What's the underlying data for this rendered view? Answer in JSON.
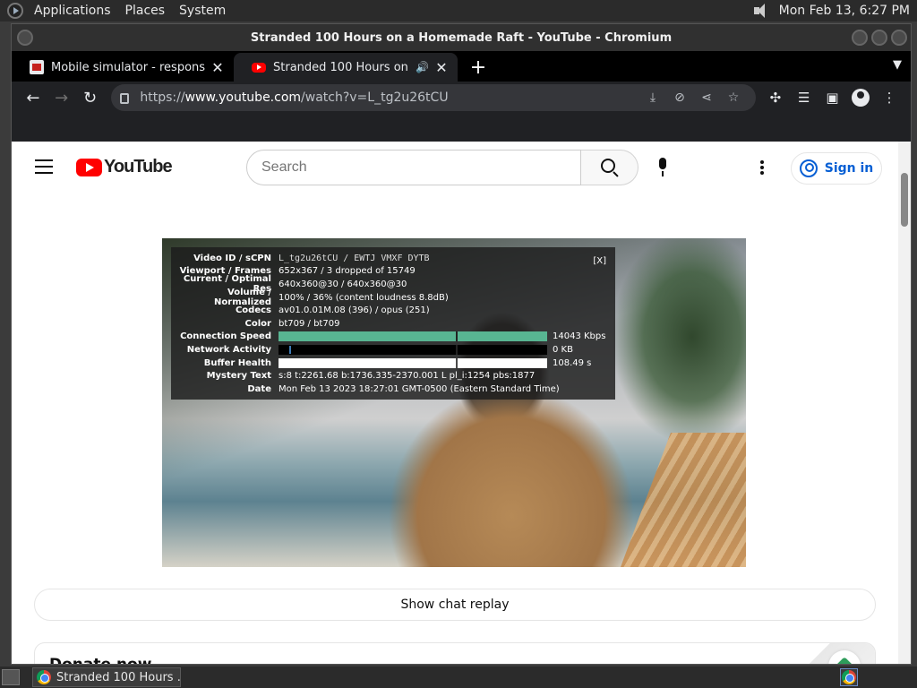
{
  "desktop": {
    "menus": [
      "Applications",
      "Places",
      "System"
    ],
    "clock": "Mon Feb 13,  6:27 PM",
    "taskbar_task": "Stranded 100 Hours ..."
  },
  "window": {
    "title": "Stranded 100 Hours on a Homemade Raft - YouTube - Chromium"
  },
  "tabs": [
    {
      "title": "Mobile simulator - responsive",
      "close": "✕"
    },
    {
      "title": "Stranded 100 Hours on a Homemade Raft - YouTube",
      "close": "✕",
      "audio": "🔊"
    }
  ],
  "toolbar": {
    "url_scheme": "https://",
    "url_host": "www.youtube.com",
    "url_path": "/watch?v=L_tg2u26tCU"
  },
  "youtube": {
    "logo_text": "YouTube",
    "search_placeholder": "Search",
    "sign_in": "Sign in",
    "show_chat_replay": "Show chat replay",
    "donate_title": "Donate now"
  },
  "stats": {
    "close": "[X]",
    "rows": [
      {
        "label": "Video ID / sCPN",
        "value": "L_tg2u26tCU / EWTJ VMXF DYTB"
      },
      {
        "label": "Viewport / Frames",
        "value": "652x367 / 3 dropped of 15749"
      },
      {
        "label": "Current / Optimal Res",
        "value": "640x360@30 / 640x360@30"
      },
      {
        "label": "Volume / Normalized",
        "value": "100% / 36% (content loudness 8.8dB)"
      },
      {
        "label": "Codecs",
        "value": "av01.0.01M.08 (396) / opus (251)"
      },
      {
        "label": "Color",
        "value": "bt709 / bt709"
      },
      {
        "label": "Connection Speed",
        "value": "14043 Kbps"
      },
      {
        "label": "Network Activity",
        "value": "0 KB"
      },
      {
        "label": "Buffer Health",
        "value": "108.49 s"
      },
      {
        "label": "Mystery Text",
        "value": "s:8 t:2261.68 b:1736.335-2370.001 L pl_i:1254 pbs:1877"
      },
      {
        "label": "Date",
        "value": "Mon Feb 13 2023 18:27:01 GMT-0500 (Eastern Standard Time)"
      }
    ]
  }
}
